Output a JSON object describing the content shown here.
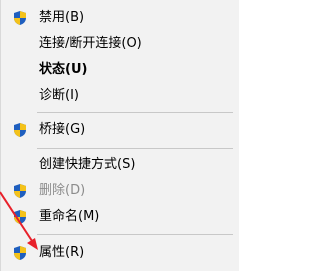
{
  "menu": {
    "items": [
      {
        "label": "禁用(B)"
      },
      {
        "label": "连接/断开连接(O)"
      },
      {
        "label": "状态(U)"
      },
      {
        "label": "诊断(I)"
      },
      {
        "label": "桥接(G)"
      },
      {
        "label": "创建快捷方式(S)"
      },
      {
        "label": "删除(D)"
      },
      {
        "label": "重命名(M)"
      },
      {
        "label": "属性(R)"
      }
    ]
  },
  "colors": {
    "menu_background": "#f2f2f2",
    "separator": "#c8c8c8",
    "disabled_text": "#8c8c8c",
    "shield_blue": "#1f5fbf",
    "shield_yellow": "#f4c21a",
    "annotation_arrow": "#e8202a"
  },
  "icons": {
    "shield": "uac-shield-icon"
  }
}
